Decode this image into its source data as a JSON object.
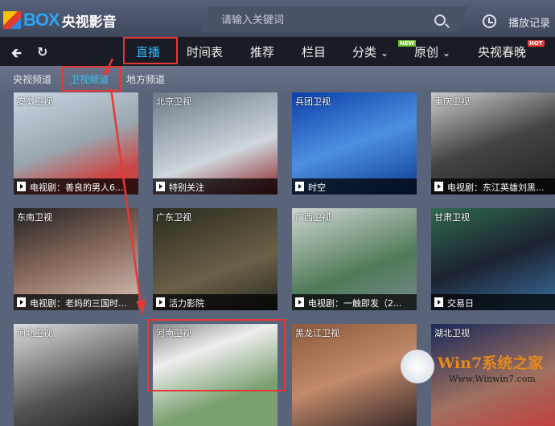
{
  "header": {
    "logo_box": "BOX",
    "logo_cn": "央视影音",
    "search_placeholder": "请输入关键词",
    "history_label": "播放记录"
  },
  "nav": {
    "items": [
      "直播",
      "时间表",
      "推荐",
      "栏目",
      "分类",
      "原创",
      "央视春晚"
    ],
    "badge_new": "NEW",
    "badge_hot": "HOT"
  },
  "subnav": {
    "items": [
      "央视频道",
      "卫视频道",
      "地方频道"
    ]
  },
  "channels": [
    {
      "name": "安徽卫视",
      "program": "电视剧：善良的男人6..."
    },
    {
      "name": "北京卫视",
      "program": "特别关注"
    },
    {
      "name": "兵团卫视",
      "program": "时空"
    },
    {
      "name": "重庆卫视",
      "program": "电视剧：东江英雄刘黑..."
    },
    {
      "name": "东南卫视",
      "program": "电视剧：老妈的三国时..."
    },
    {
      "name": "广东卫视",
      "program": "活力影院"
    },
    {
      "name": "广西卫视",
      "program": "电视剧：一触即发（2..."
    },
    {
      "name": "甘肃卫视",
      "program": "交易日"
    },
    {
      "name": "河北卫视",
      "program": ""
    },
    {
      "name": "河南卫视",
      "program": ""
    },
    {
      "name": "黑龙江卫视",
      "program": ""
    },
    {
      "name": "湖北卫视",
      "program": ""
    }
  ],
  "watermark": {
    "title": "Win7系统之家",
    "url": "Www.Winwin7.com"
  }
}
